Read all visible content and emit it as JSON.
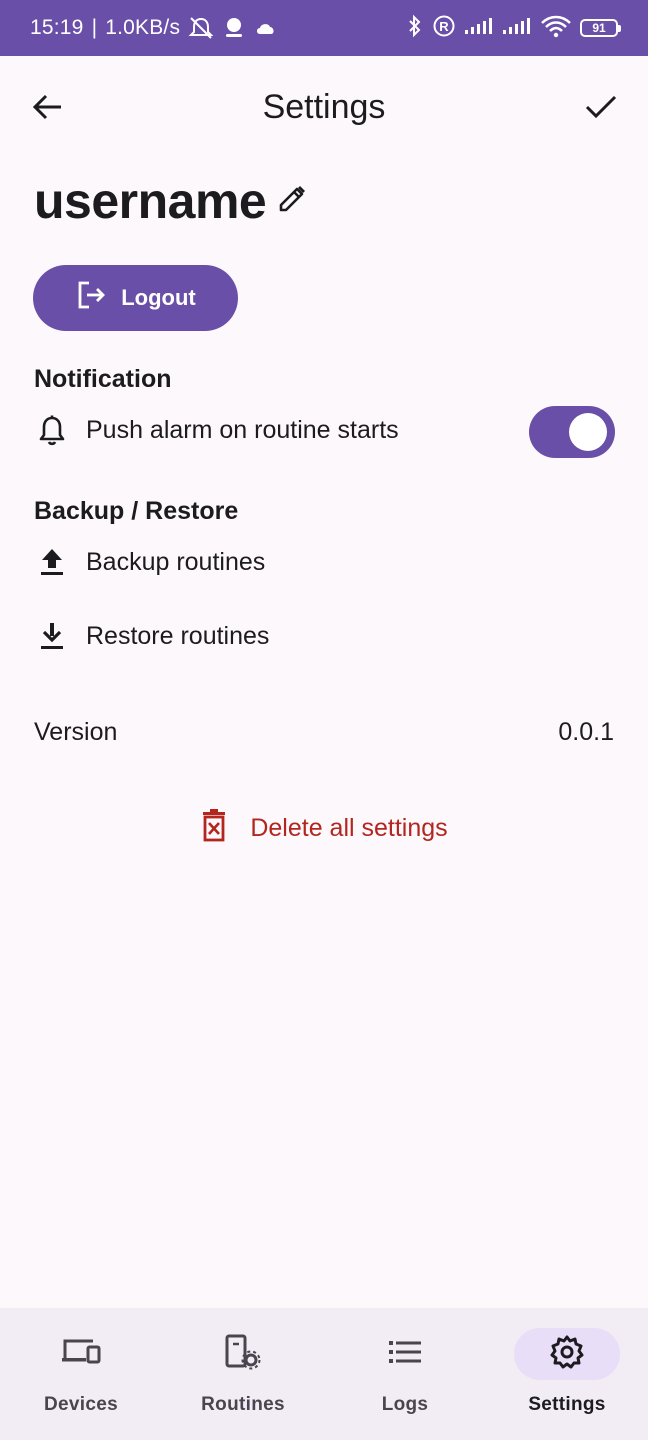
{
  "status_bar": {
    "time": "15:19",
    "network_speed": "1.0KB/s",
    "battery_level": "91",
    "icons": [
      "muted-alarm-icon",
      "weather-icon",
      "cloud-icon",
      "bluetooth-icon",
      "registered-icon",
      "signal-icon",
      "signal-icon",
      "wifi-icon",
      "battery-icon"
    ]
  },
  "app_bar": {
    "title": "Settings",
    "back_icon": "arrow-left-icon",
    "confirm_icon": "check-icon"
  },
  "profile": {
    "username": "username",
    "edit_icon": "pencil-icon",
    "logout_label": "Logout",
    "logout_icon": "logout-icon"
  },
  "notification": {
    "section_title": "Notification",
    "push_alarm_label": "Push alarm on routine starts",
    "push_alarm_enabled": true,
    "icon": "bell-icon"
  },
  "backup_restore": {
    "section_title": "Backup / Restore",
    "backup_label": "Backup routines",
    "backup_icon": "upload-icon",
    "restore_label": "Restore routines",
    "restore_icon": "download-icon"
  },
  "version": {
    "label": "Version",
    "value": "0.0.1"
  },
  "danger": {
    "delete_label": "Delete all settings",
    "delete_icon": "trash-icon",
    "color": "#b3261e"
  },
  "bottom_nav": {
    "items": [
      {
        "label": "Devices",
        "icon": "devices-icon",
        "active": false
      },
      {
        "label": "Routines",
        "icon": "routines-icon",
        "active": false
      },
      {
        "label": "Logs",
        "icon": "list-icon",
        "active": false
      },
      {
        "label": "Settings",
        "icon": "gear-icon",
        "active": true
      }
    ]
  },
  "colors": {
    "primary": "#6a4fa8",
    "background": "#fdf8fc",
    "nav_background": "#f2ecf4",
    "nav_active_indicator": "#e8def8"
  }
}
